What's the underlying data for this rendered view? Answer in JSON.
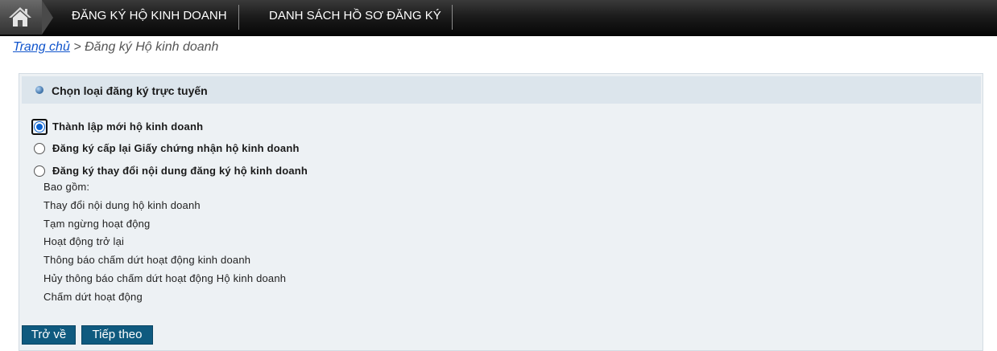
{
  "nav": {
    "items": [
      "ĐĂNG KÝ HỘ KINH DOANH",
      "DANH SÁCH HỒ SƠ ĐĂNG KÝ"
    ]
  },
  "breadcrumb": {
    "home": "Trang chủ",
    "separator": ">",
    "current": "Đăng ký Hộ kinh doanh"
  },
  "panel": {
    "title": "Chọn loại đăng ký trực tuyến",
    "options": [
      {
        "label": "Thành lập mới hộ kinh doanh",
        "selected": true
      },
      {
        "label": "Đăng ký cấp lại Giấy chứng nhận hộ kinh doanh",
        "selected": false
      },
      {
        "label": "Đăng ký thay đổi nội dung đăng ký hộ kinh doanh",
        "selected": false
      }
    ],
    "includes_label": "Bao gồm:",
    "includes": [
      "Thay đổi nội dung hộ kinh doanh",
      "Tạm ngừng hoạt động",
      "Hoạt động trở lại",
      "Thông báo chấm dứt hoạt động kinh doanh",
      "Hủy thông báo chấm dứt hoạt động Hộ kinh doanh",
      "Chấm dứt hoạt động"
    ]
  },
  "buttons": {
    "back": "Trở về",
    "next": "Tiếp theo"
  },
  "colors": {
    "accent": "#0f5a7f",
    "radio_selected": "#0b63d1",
    "link": "#1155cc",
    "panel_bg": "#edf1f4",
    "header_bg": "#dce5ec"
  },
  "icons": {
    "home": "home-icon",
    "title_bullet": "bullet-icon"
  }
}
